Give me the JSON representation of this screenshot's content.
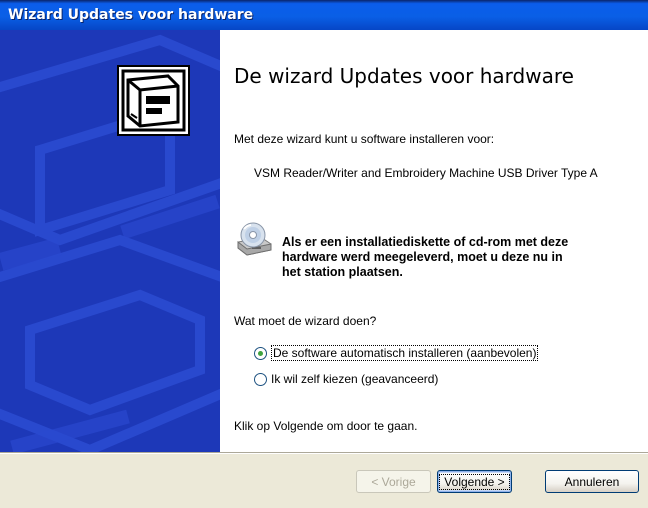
{
  "window": {
    "title": "Wizard Updates voor hardware"
  },
  "content": {
    "heading": "De wizard Updates voor hardware",
    "intro": "Met deze wizard kunt u software installeren voor:",
    "device": "VSM Reader/Writer and Embroidery Machine USB Driver Type A",
    "cd_notice": "Als er een installatiediskette of cd-rom met deze hardware werd meegeleverd, moet u deze nu in het station plaatsen.",
    "question": "Wat moet de wizard doen?",
    "options": [
      {
        "label": "De software automatisch installeren (aanbevolen)",
        "selected": true
      },
      {
        "label": "Ik wil zelf kiezen (geavanceerd)",
        "selected": false
      }
    ],
    "footer": "Klik op Volgende om door te gaan."
  },
  "buttons": {
    "back": "< Vorige",
    "next": "Volgende >",
    "cancel": "Annuleren"
  },
  "colors": {
    "titlebar": "#0A5FE6",
    "banner": "#1D38B8",
    "radio_dot": "#3FA33F"
  },
  "icons": {
    "wizard": "hardware-box-icon",
    "cd": "cd-rom-icon"
  }
}
